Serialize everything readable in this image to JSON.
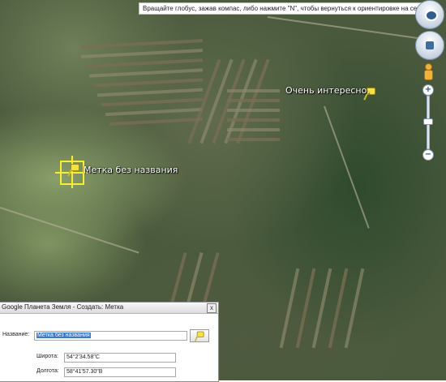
{
  "hint": "Вращайте глобус, зажав компас, либо нажмите \"N\", чтобы вернуться к ориентировке на север",
  "placemarks": [
    {
      "label": "Очень интересно."
    },
    {
      "label": "Метка без названия"
    }
  ],
  "nav": {
    "zoom_in": "+",
    "zoom_out": "−"
  },
  "dialog": {
    "title": "Google Планета Земля - Создать: Метка",
    "close": "x",
    "name_label": "Название:",
    "name_value": "Метка без названия",
    "lat_label": "Широта:",
    "lat_value": "54°2'34.58\"С",
    "lon_label": "Долгота:",
    "lon_value": "58°41'57.30\"В"
  },
  "colors": {
    "pin": "#f3e33a",
    "selection": "#f7ef2c",
    "text_selection": "#3a78d6"
  }
}
